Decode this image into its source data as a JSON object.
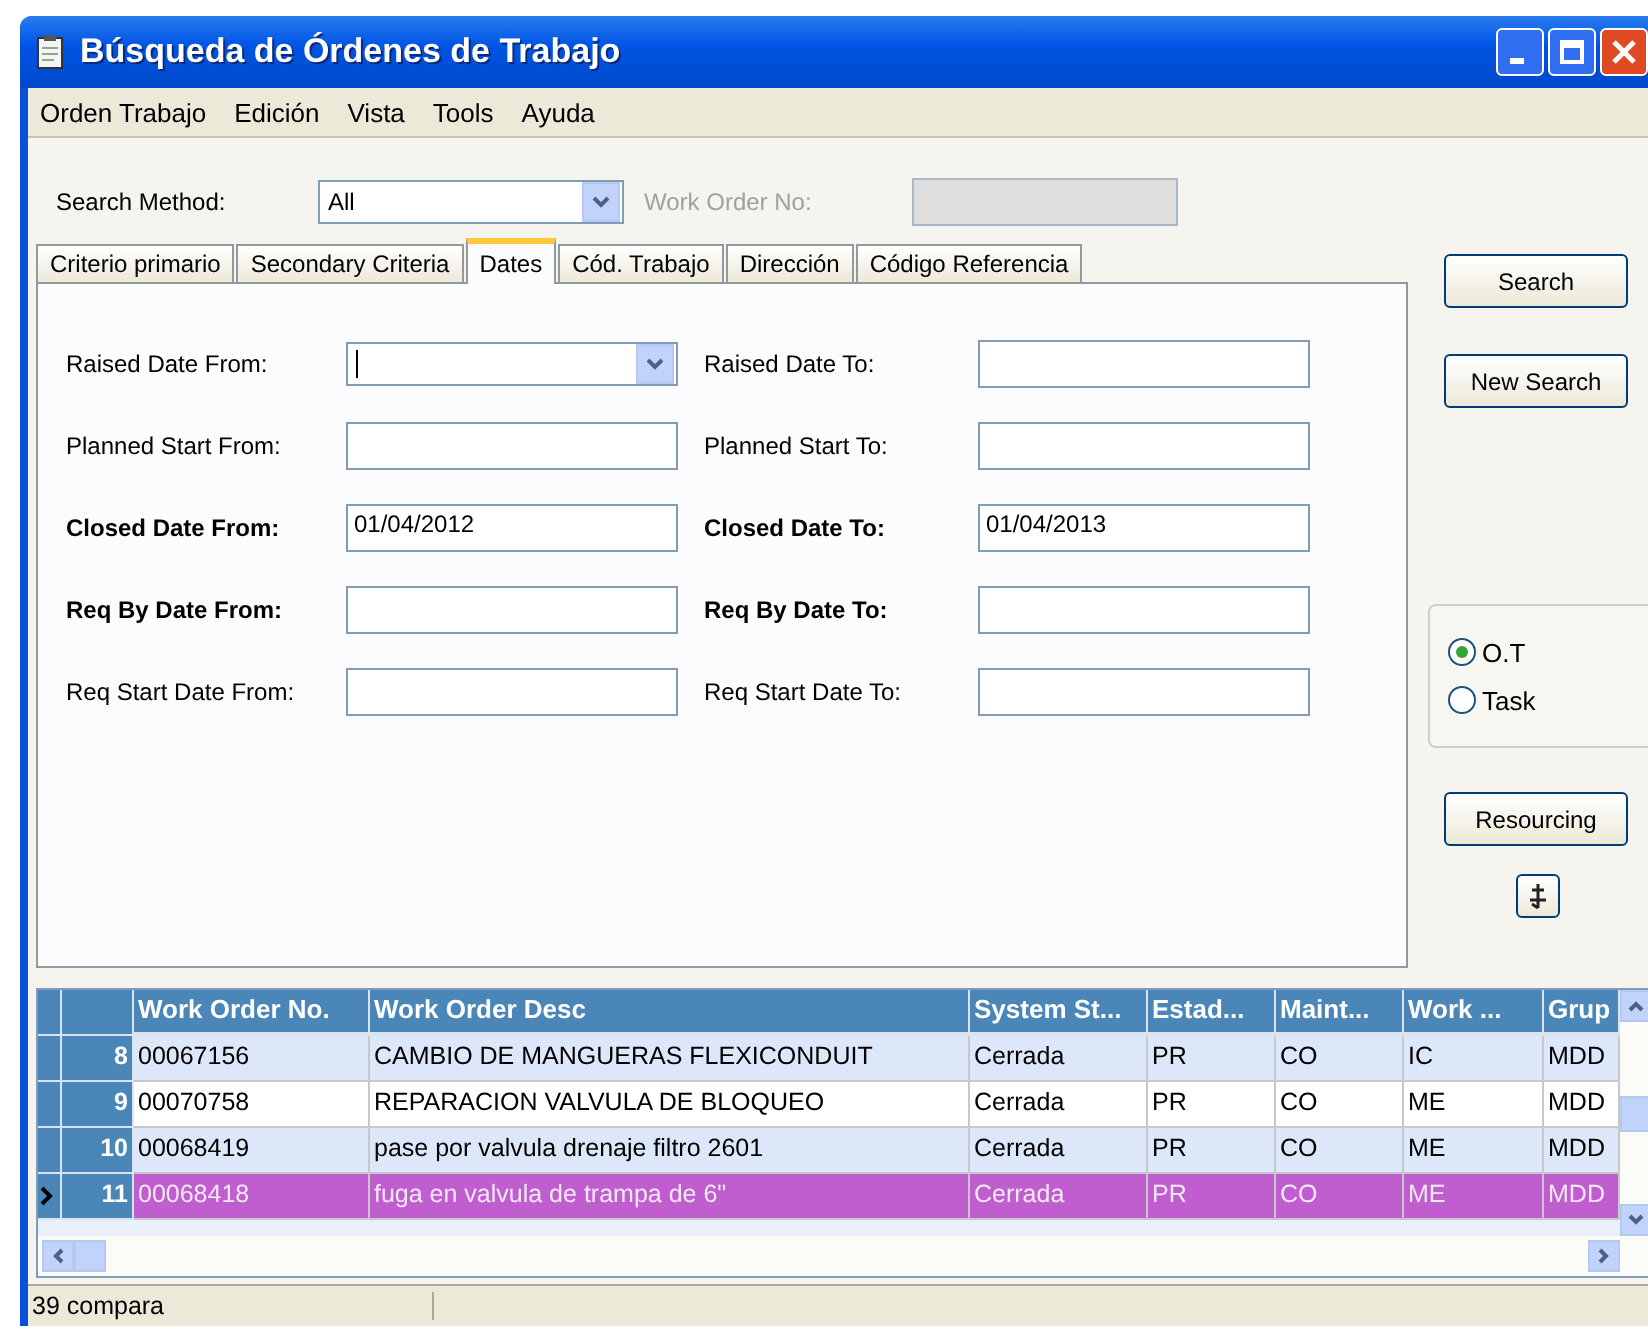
{
  "window": {
    "title": "Búsqueda de Órdenes de Trabajo"
  },
  "menu": [
    "Orden Trabajo",
    "Edición",
    "Vista",
    "Tools",
    "Ayuda"
  ],
  "search_method": {
    "label": "Search Method:",
    "value": "All"
  },
  "work_order_no": {
    "label": "Work Order No:",
    "disabled": true
  },
  "tabs": [
    {
      "label": "Criterio primario",
      "selected": false
    },
    {
      "label": "Secondary Criteria",
      "selected": false
    },
    {
      "label": "Dates",
      "selected": true
    },
    {
      "label": "Cód. Trabajo",
      "selected": false
    },
    {
      "label": "Dirección",
      "selected": false
    },
    {
      "label": "Código Referencia",
      "selected": false
    }
  ],
  "date_rows": [
    {
      "from": {
        "label": "Raised Date From:",
        "bold": false,
        "kind": "combo"
      },
      "to": {
        "label": "Raised Date To:",
        "bold": false,
        "kind": "text"
      }
    },
    {
      "from": {
        "label": "Planned Start From:",
        "bold": false,
        "kind": "text"
      },
      "to": {
        "label": "Planned Start To:",
        "bold": false,
        "kind": "text"
      }
    },
    {
      "from": {
        "label": "Closed Date From:",
        "bold": true,
        "kind": "text",
        "value": "01/04/2012"
      },
      "to": {
        "label": "Closed Date To:",
        "bold": true,
        "kind": "text",
        "value": "01/04/2013"
      }
    },
    {
      "from": {
        "label": "Req By Date From:",
        "bold": true,
        "kind": "text"
      },
      "to": {
        "label": "Req By Date To:",
        "bold": true,
        "kind": "text"
      }
    },
    {
      "from": {
        "label": "Req Start Date From:",
        "bold": false,
        "kind": "text"
      },
      "to": {
        "label": "Req Start Date To:",
        "bold": false,
        "kind": "text"
      }
    }
  ],
  "buttons": [
    "Search",
    "New Search"
  ],
  "mode_options": [
    {
      "label": "O.T",
      "selected": true
    },
    {
      "label": "Task",
      "selected": false
    }
  ],
  "resourcing_button": "Resourcing",
  "grid": {
    "columns": [
      "Work Order No.",
      "Work Order Desc",
      "System St...",
      "Estad...",
      "Maint...",
      "Work ...",
      "Grup"
    ],
    "rows": [
      {
        "number": "8",
        "cells": [
          "00067156",
          "CAMBIO DE MANGUERAS FLEXICONDUIT",
          "Cerrada",
          "PR",
          "CO",
          "IC",
          "MDD"
        ],
        "selected": false
      },
      {
        "number": "9",
        "cells": [
          "00070758",
          "REPARACION VALVULA DE BLOQUEO",
          "Cerrada",
          "PR",
          "CO",
          "ME",
          "MDD"
        ],
        "selected": false
      },
      {
        "number": "10",
        "cells": [
          "00068419",
          "pase  por valvula drenaje filtro 2601",
          "Cerrada",
          "PR",
          "CO",
          "ME",
          "MDD"
        ],
        "selected": false
      },
      {
        "number": "11",
        "cells": [
          "00068418",
          "fuga en valvula de trampa de 6\"",
          "Cerrada",
          "PR",
          "CO",
          "ME",
          "MDD"
        ],
        "selected": true
      }
    ]
  },
  "status_bar": "39 compara"
}
